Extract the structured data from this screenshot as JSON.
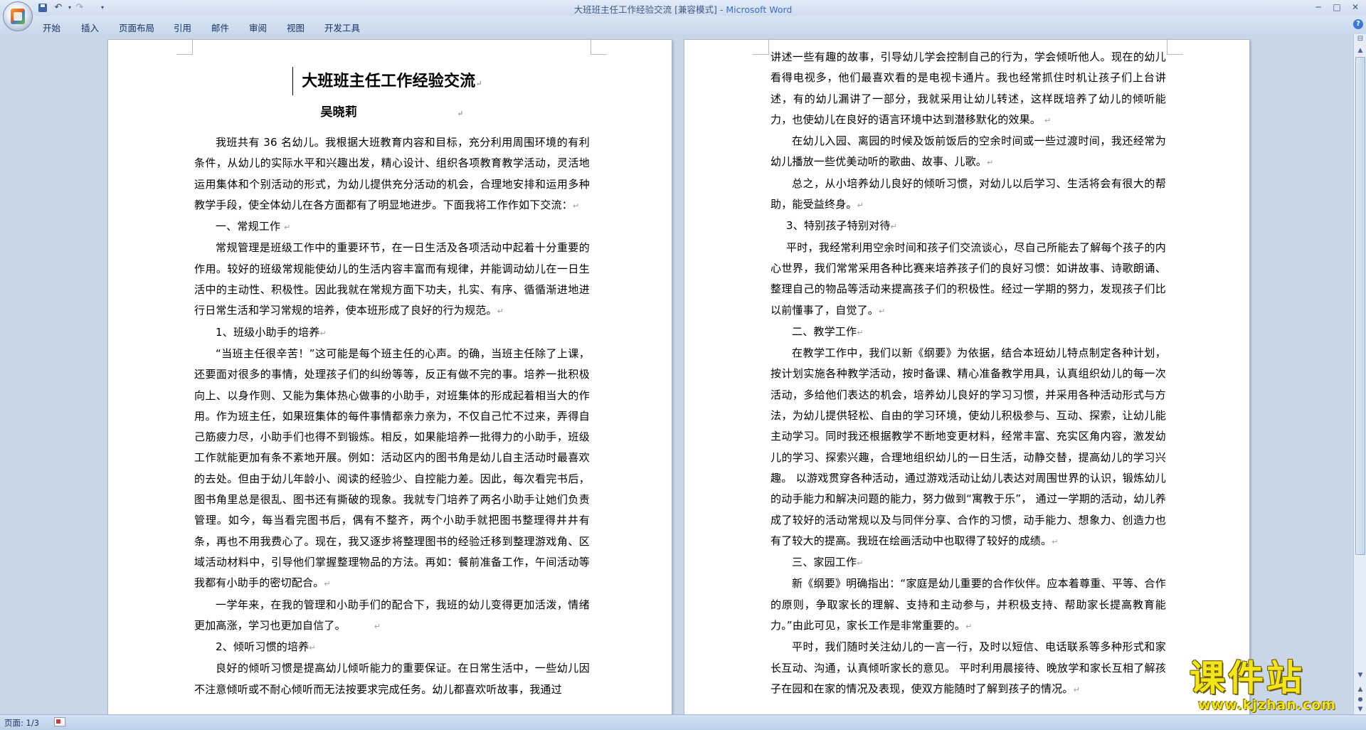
{
  "window": {
    "title_doc": "大班班主任工作经验交流 [兼容模式]",
    "title_sep": " - ",
    "title_app": "Microsoft Word"
  },
  "icons": {
    "office": "office-button-icon",
    "save": "save-icon",
    "undo": "undo-icon",
    "redo": "redo-icon",
    "customize": "chevron-down-icon",
    "help": "help-icon"
  },
  "ribbon": {
    "tabs": [
      "开始",
      "插入",
      "页面布局",
      "引用",
      "邮件",
      "审阅",
      "视图",
      "开发工具"
    ]
  },
  "glyphs": {
    "undo": "↶",
    "redo": "↷",
    "dropdown": "▾",
    "customize": "▾",
    "minimize": "─",
    "maximize": "□",
    "close": "✕",
    "help": "?",
    "scroll_up": "▲",
    "scroll_down": "▼",
    "prev_page": "▲",
    "select_browse": "●",
    "next_page": "▼",
    "ruler": "⊟",
    "para_mark": "↵"
  },
  "document": {
    "left_page": {
      "title": "大班班主任工作经验交流",
      "author": "吴晓莉",
      "paragraphs": [
        "我班共有 36 名幼儿。我根据大班教育内容和目标，充分利用周围环境的有利条件，从幼儿的实际水平和兴趣出发，精心设计、组织各项教育教学活动，灵活地运用集体和个别活动的形式，为幼儿提供充分活动的机会，合理地安排和运用多种教学手段，使全体幼儿在各方面都有了明显地进步。下面我将工作作如下交流：",
        "一、常规工作",
        "常规管理是班级工作中的重要环节，在一日生活及各项活动中起着十分重要的作用。较好的班级常规能使幼儿的生活内容丰富而有规律，并能调动幼儿在一日生活中的主动性、积极性。因此我就在常规方面下功夫，扎实、有序、循循渐进地进行日常生活和学习常规的培养，使本班形成了良好的行为规范。",
        "1、班级小助手的培养",
        "“当班主任很辛苦！”这可能是每个班主任的心声。的确，当班主任除了上课，还要面对很多的事情，处理孩子们的纠纷等等，反正有做不完的事。培养一批积极向上、以身作则、又能为集体热心做事的小助手，对班集体的形成起着相当大的作用。作为班主任，如果班集体的每件事情都亲力亲为，不仅自己忙不过来，弄得自己筋疲力尽，小助手们也得不到锻炼。相反，如果能培养一批得力的小助手，班级工作就能更加有条不紊地开展。例如：活动区内的图书角是幼儿自主活动时最喜欢的去处。但由于幼儿年龄小、阅读的经验少、自控能力差。因此，每次看完书后，图书角里总是很乱、图书还有撕破的现象。我就专门培养了两名小助手让她们负责管理。如今，每当看完图书后，偶有不整齐，两个小助手就把图书整理得井井有条，再也不用我费心了。现在，我又逐步将整理图书的经验迁移到整理游戏角、区域活动材料中，引导他们掌握整理物品的方法。再如：餐前准备工作，午间活动等我都有小助手的密切配合。",
        "一学年来，在我的管理和小助手们的配合下，我班的幼儿变得更加活泼，情绪更加高涨，学习也更加自信了。",
        "2、倾听习惯的培养",
        "良好的倾听习惯是提高幼儿倾听能力的重要保证。在日常生活中，一些幼儿因不注意倾听或不耐心倾听而无法按要求完成任务。幼儿都喜欢听故事，我通过"
      ]
    },
    "right_page": {
      "paragraphs": [
        "讲述一些有趣的故事，引导幼儿学会控制自己的行为，学会倾听他人。现在的幼儿看得电视多，他们最喜欢看的是电视卡通片。我也经常抓住时机让孩子们上台讲述，有的幼儿漏讲了一部分，我就采用让幼儿转述，这样既培养了幼儿的倾听能力，也使幼儿在良好的语言环境中达到潜移默化的效果。",
        "在幼儿入园、离园的时候及饭前饭后的空余时间或一些过渡时间，我还经常为幼儿播放一些优美动听的歌曲、故事、儿歌。",
        "总之，从小培养幼儿良好的倾听习惯，对幼儿以后学习、生活将会有很大的帮助，能受益终身。",
        "3、特别孩子特别对待",
        "平时，我经常利用空余时间和孩子们交流谈心，尽自己所能去了解每个孩子的内心世界，我们常常采用各种比赛来培养孩子们的良好习惯：如讲故事、诗歌朗诵、整理自己的物品等活动来提高孩子们的积极性。经过一学期的努力，发现孩子们比以前懂事了，自觉了。",
        "二、教学工作",
        "在教学工作中，我们以新《纲要》为依据，结合本班幼儿特点制定各种计划，按计划实施各种教学活动，按时备课、精心准备教学用具，认真组织幼儿的每一次活动，多给他们表达的机会，培养幼儿良好的学习习惯，并采用各种活动形式与方法，为幼儿提供轻松、自由的学习环境，使幼儿积极参与、互动、探索，让幼儿能主动学习。同时我还根据教学不断地变更材料，经常丰富、充实区角内容，激发幼儿的学习、探索兴趣，合理地组织幼儿的一日生活，动静交替，提高幼儿的学习兴趣。  以游戏贯穿各种活动，通过游戏活动让幼儿表达对周围世界的认识，锻炼幼儿的动手能力和解决问题的能力，努力做到“寓教于乐”，  通过一学期的活动，幼儿养成了较好的活动常规以及与同伴分享、合作的习惯，动手能力、想象力、创造力也有了较大的提高。我班在绘画活动中也取得了较好的成绩。",
        "三、家园工作",
        "新《纲要》明确指出：“家庭是幼儿重要的合作伙伴。应本着尊重、平等、合作的原则，争取家长的理解、支持和主动参与，并积极支持、帮助家长提高教育能力。”由此可见，家长工作是非常重要的。",
        "平时，我们随时关注幼儿的一言一行，及时以短信、电话联系等多种形式和家长互动、沟通，认真倾听家长的意见。  平时利用晨接待、晚放学和家长互相了解孩子在园和在家的情况及表现，使双方能随时了解到孩子的情况。"
      ]
    }
  },
  "status": {
    "page": "页面: 1/3"
  },
  "watermark": {
    "main": "课件站",
    "url": "www.kjzhan.com"
  }
}
